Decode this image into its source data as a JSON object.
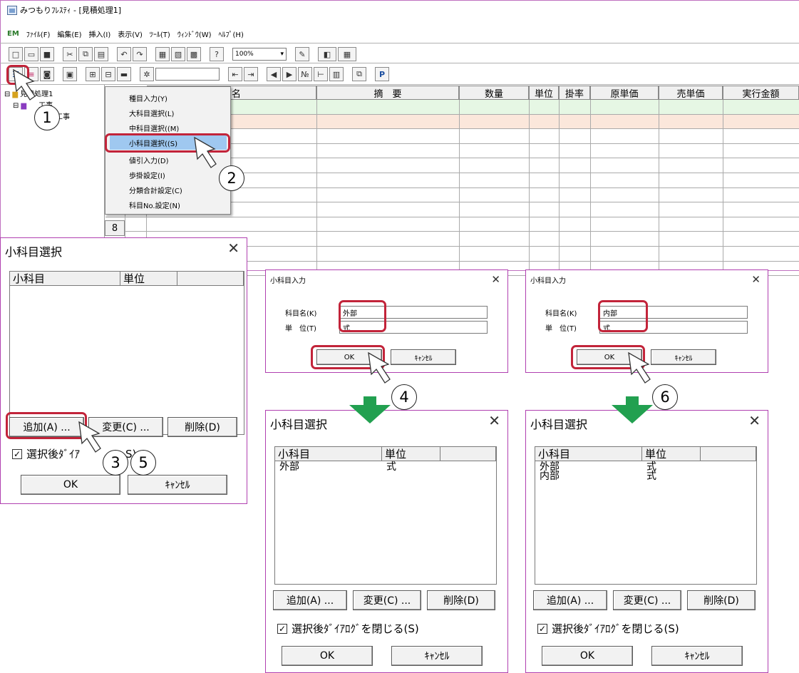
{
  "window": {
    "title": "みつもりﾌﾚｽﾃｨ - [見積処理1]"
  },
  "menubar": [
    "ﾌｧｲﾙ(F)",
    "編集(E)",
    "挿入(I)",
    "表示(V)",
    "ﾂｰﾙ(T)",
    "ｳｨﾝﾄﾞｳ(W)",
    "ﾍﾙﾌﾟ(H)"
  ],
  "menubar_logo": "EM",
  "toolbar": {
    "zoom": "100%"
  },
  "tree": {
    "root": "見積処理1",
    "child1": "工事",
    "child2": "ｲﾙ工事"
  },
  "grid": {
    "headers": [
      "目名",
      "摘　要",
      "数量",
      "単位",
      "掛率",
      "原単価",
      "売単価",
      "実行金額"
    ],
    "row_number": "8",
    "row_colors": [
      "#e6f7e4",
      "#fbe7db"
    ]
  },
  "context_menu": {
    "items": [
      "種目入力(Y)",
      "大科目選択(L)",
      "中科目選択((M)",
      "小科目選択((S)",
      "値引入力(D)",
      "歩掛設定(I)",
      "分類合計設定(C)",
      "科目No.設定(N)"
    ],
    "selected_index": 3
  },
  "dialog_select": {
    "title": "小科目選択",
    "col_item": "小科目",
    "col_unit": "単位",
    "add": "追加(A) ...",
    "change": "変更(C) ...",
    "delete": "削除(D)",
    "close_after": "選択後ﾀﾞｲｱﾛｸﾞを閉じる(S)",
    "close_after_visible": "選択後ﾀﾞｲｱ",
    "close_after_tail": "S)",
    "ok": "OK",
    "cancel": "ｷｬﾝｾﾙ"
  },
  "dialog_input_1": {
    "title": "小科目入力",
    "name_label": "科目名(K)",
    "unit_label": "単　位(T)",
    "name": "外部",
    "unit": "式",
    "ok": "OK",
    "cancel": "ｷｬﾝｾﾙ"
  },
  "dialog_input_2": {
    "title": "小科目入力",
    "name_label": "科目名(K)",
    "unit_label": "単　位(T)",
    "name": "内部",
    "unit": "式",
    "ok": "OK",
    "cancel": "ｷｬﾝｾﾙ"
  },
  "list_after_1": [
    {
      "name": "外部",
      "unit": "式"
    }
  ],
  "list_after_2": [
    {
      "name": "外部",
      "unit": "式"
    },
    {
      "name": "内部",
      "unit": "式"
    }
  ],
  "steps": [
    "1",
    "2",
    "3",
    "5",
    "4",
    "6"
  ],
  "colors": {
    "highlight": "#c2243a",
    "dialog_border": "#b040b0",
    "flow_arrow": "#22a050",
    "menu_selected": "#9fc8f0"
  }
}
